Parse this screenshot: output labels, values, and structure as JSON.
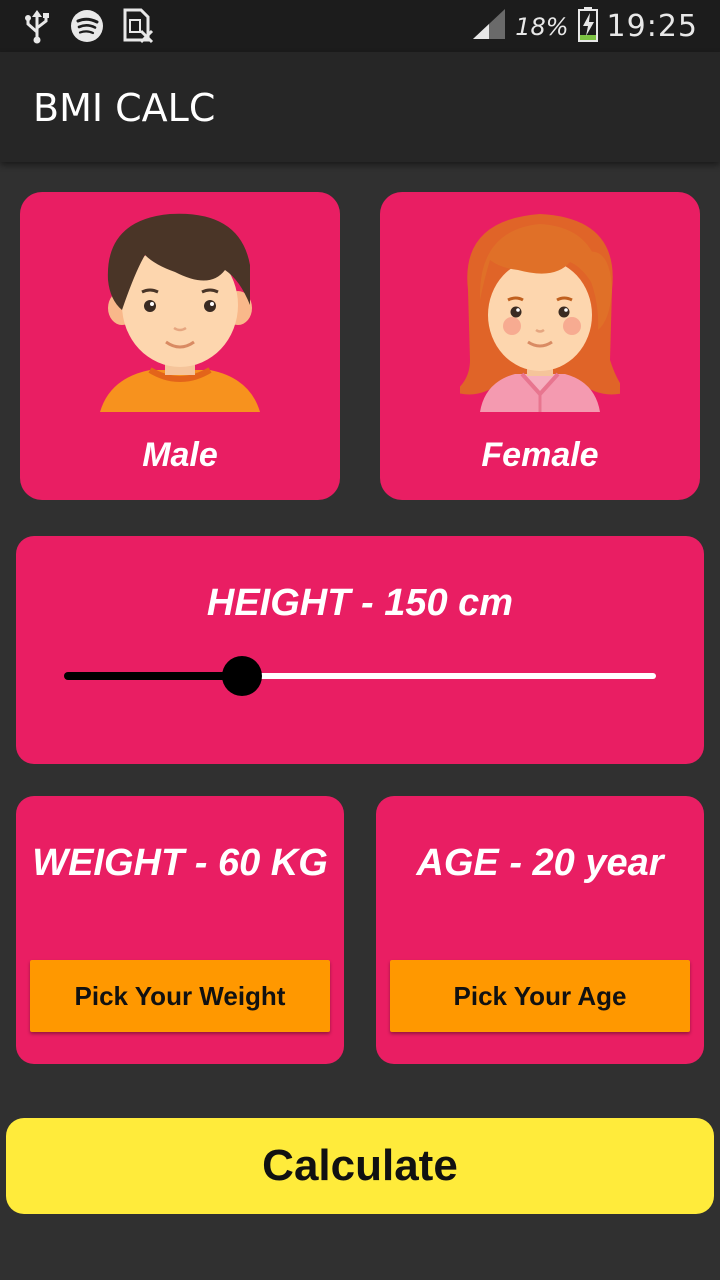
{
  "status_bar": {
    "battery": "18%",
    "time": "19:25",
    "icons": [
      "usb-icon",
      "spotify-icon",
      "no-sim-icon",
      "signal-icon",
      "battery-charging-icon"
    ]
  },
  "app_bar": {
    "title": "BMI CALC"
  },
  "gender": {
    "male_label": "Male",
    "female_label": "Female"
  },
  "height": {
    "label": "HEIGHT - 150 cm",
    "slider_fraction": 0.3
  },
  "weight": {
    "label": "WEIGHT - 60 KG",
    "button_label": "Pick Your Weight"
  },
  "age": {
    "label": "AGE - 20 year",
    "button_label": "Pick Your Age"
  },
  "calculate_label": "Calculate",
  "colors": {
    "background": "#303030",
    "card": "#e91e63",
    "pick_button": "#ff9800",
    "calculate_button": "#ffeb3b"
  }
}
